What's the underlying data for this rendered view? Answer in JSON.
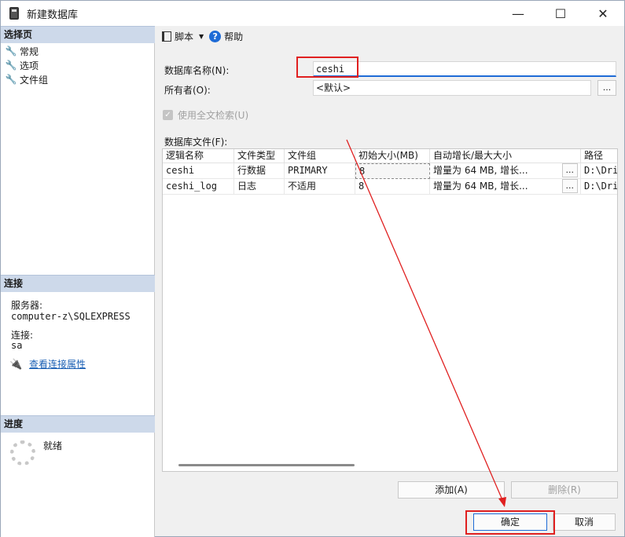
{
  "window": {
    "title": "新建数据库"
  },
  "window_controls": {
    "minimize": "—",
    "maximize": "☐",
    "close": "✕"
  },
  "left_pane": {
    "select_page_header": "选择页",
    "pages": [
      {
        "label": "常规"
      },
      {
        "label": "选项"
      },
      {
        "label": "文件组"
      }
    ],
    "connection_header": "连接",
    "server_label": "服务器:",
    "server_value": "computer-z\\SQLEXPRESS",
    "connection_label": "连接:",
    "connection_value": "sa",
    "view_connection_properties": "查看连接属性",
    "progress_header": "进度",
    "progress_status": "就绪"
  },
  "toolbar": {
    "script_label": "脚本",
    "help_label": "帮助"
  },
  "form": {
    "db_name_label": "数据库名称(N):",
    "db_name_value": "ceshi",
    "owner_label": "所有者(O):",
    "owner_value": "<默认>",
    "owner_browse": "...",
    "fulltext_label": "使用全文检索(U)",
    "files_label": "数据库文件(F):"
  },
  "files_grid": {
    "columns": [
      "逻辑名称",
      "文件类型",
      "文件组",
      "初始大小(MB)",
      "自动增长/最大大小",
      "路径"
    ],
    "rows": [
      {
        "logical": "ceshi",
        "type": "行数据",
        "filegroup": "PRIMARY",
        "size": "8",
        "growth": "增量为 64 MB, 增长...",
        "browse": "...",
        "path": "D:\\Dri"
      },
      {
        "logical": "ceshi_log",
        "type": "日志",
        "filegroup": "不适用",
        "size": "8",
        "growth": "增量为 64 MB, 增长...",
        "browse": "...",
        "path": "D:\\Dri"
      }
    ]
  },
  "buttons": {
    "add": "添加(A)",
    "remove": "删除(R)",
    "ok": "确定",
    "cancel": "取消"
  },
  "colors": {
    "annotation": "#e02020",
    "section_header": "#cdd9ea",
    "link": "#1a5fb4"
  }
}
